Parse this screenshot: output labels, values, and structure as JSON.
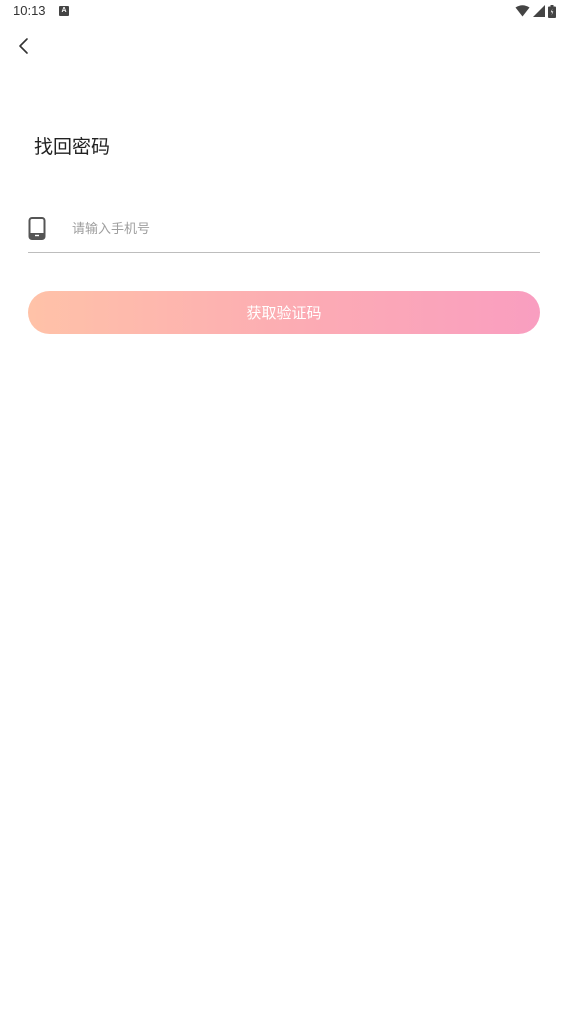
{
  "status_bar": {
    "time": "10:13",
    "notification_icon": "a-box-icon",
    "icons": [
      "wifi-icon",
      "signal-icon",
      "battery-icon"
    ]
  },
  "nav": {
    "back_icon": "chevron-left-icon"
  },
  "page": {
    "title": "找回密码"
  },
  "form": {
    "phone_icon": "mobile-phone-icon",
    "phone_placeholder": "请输入手机号",
    "phone_value": "",
    "submit_label": "获取验证码"
  },
  "colors": {
    "button_gradient_start": "#ffc2a8",
    "button_gradient_end": "#f99ec0",
    "button_text": "#ffffff",
    "divider": "#bdbdbd",
    "placeholder": "#9e9e9e"
  }
}
